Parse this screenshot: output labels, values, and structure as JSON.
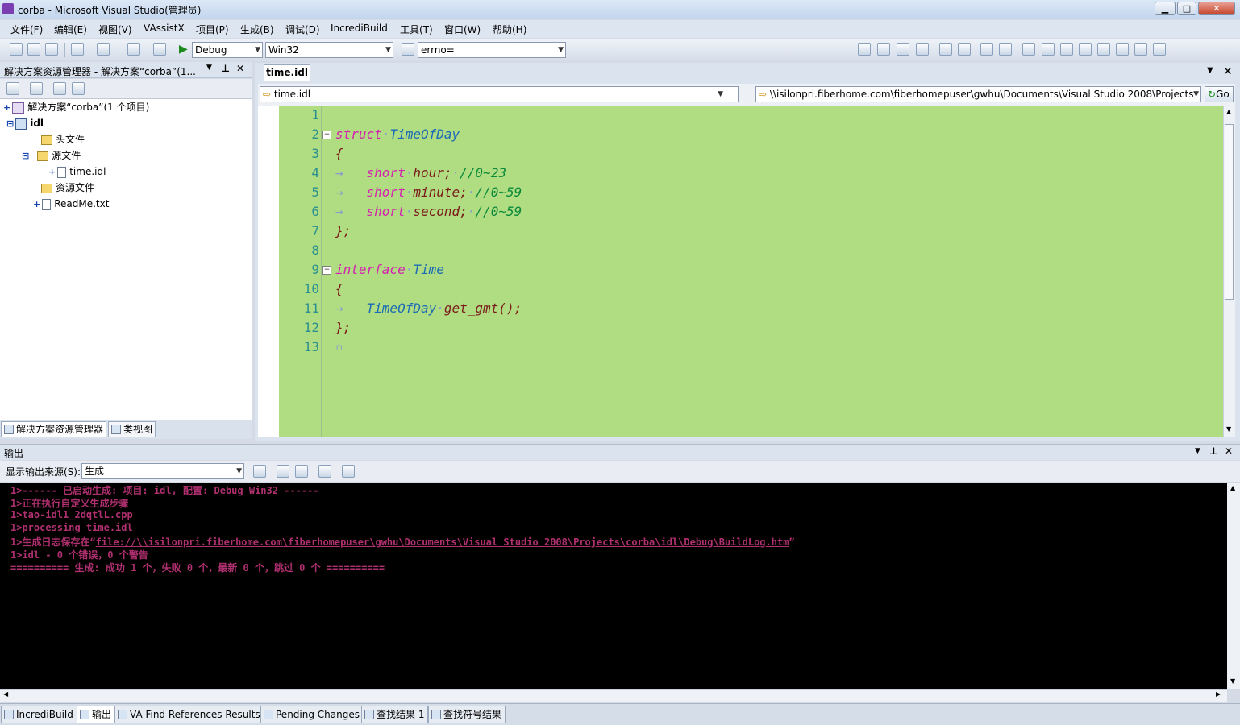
{
  "window": {
    "title": "corba - Microsoft Visual Studio(管理员)",
    "min": "▁",
    "max": "□",
    "close": "✕"
  },
  "menu": [
    "文件(F)",
    "编辑(E)",
    "视图(V)",
    "VAssistX",
    "项目(P)",
    "生成(B)",
    "调试(D)",
    "IncrediBuild",
    "工具(T)",
    "窗口(W)",
    "帮助(H)"
  ],
  "toolbar": {
    "config": "Debug",
    "platform": "Win32",
    "find": "errno="
  },
  "solution_explorer": {
    "title": "解决方案资源管理器 - 解决方案“corba”(1...",
    "items": [
      {
        "label": "解决方案“corba”(1 个项目)"
      },
      {
        "label": "idl"
      },
      {
        "label": "头文件"
      },
      {
        "label": "源文件"
      },
      {
        "label": "time.idl"
      },
      {
        "label": "资源文件"
      },
      {
        "label": "ReadMe.txt"
      }
    ],
    "tabs": [
      "解决方案资源管理器",
      "类视图"
    ]
  },
  "editor": {
    "tab": "time.idl",
    "file_combo": "time.idl",
    "path_combo": "\\\\isilonpri.fiberhome.com\\fiberhomepuser\\gwhu\\Documents\\Visual Studio 2008\\Projects",
    "go": "Go",
    "line_numbers": [
      "1",
      "2",
      "3",
      "4",
      "5",
      "6",
      "7",
      "8",
      "9",
      "10",
      "11",
      "12",
      "13"
    ],
    "code": {
      "l2_kw": "struct",
      "l2_ty": "TimeOfDay",
      "brace_open": "{",
      "brace_close": "};",
      "short": "short",
      "hour": "hour;",
      "c1": "//0~23",
      "minute": "minute;",
      "c2": "//0~59",
      "second": "second;",
      "c3": "//0~59",
      "l9_kw": "interface",
      "l9_ty": "Time",
      "l11_ty": "TimeOfDay",
      "l11_fn": "get_gmt();"
    }
  },
  "output": {
    "title": "输出",
    "source_label": "显示输出来源(S):",
    "source_value": "生成",
    "lines": [
      "1>------ 已启动生成: 项目: idl, 配置: Debug Win32 ------",
      "1>正在执行自定义生成步骤",
      "1>tao-idl1_2dqtlL.cpp",
      "1>processing time.idl",
      "1>生成日志保存在“",
      "1>idl - 0 个错误，0 个警告",
      "========== 生成: 成功 1 个，失败 0 个，最新 0 个，跳过 0 个 =========="
    ],
    "log_link": "file://\\\\isilonpri.fiberhome.com\\fiberhomepuser\\gwhu\\Documents\\Visual Studio 2008\\Projects\\corba\\idl\\Debug\\BuildLog.htm",
    "log_suffix": "”"
  },
  "bottom_tabs": [
    "IncrediBuild",
    "输出",
    "VA Find References Results",
    "Pending Changes",
    "查找结果 1",
    "查找符号结果"
  ]
}
